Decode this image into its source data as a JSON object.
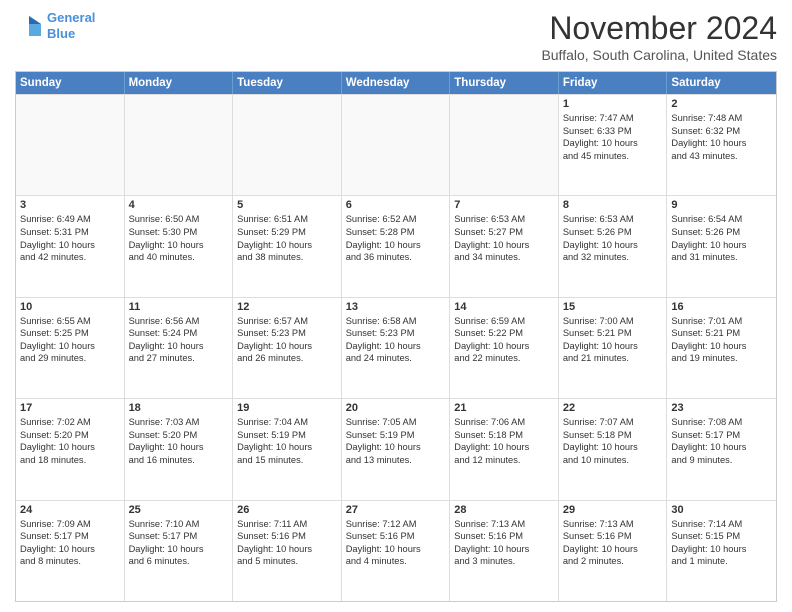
{
  "header": {
    "logo_line1": "General",
    "logo_line2": "Blue",
    "month_title": "November 2024",
    "location": "Buffalo, South Carolina, United States"
  },
  "weekdays": [
    "Sunday",
    "Monday",
    "Tuesday",
    "Wednesday",
    "Thursday",
    "Friday",
    "Saturday"
  ],
  "rows": [
    [
      {
        "day": "",
        "text": "",
        "empty": true
      },
      {
        "day": "",
        "text": "",
        "empty": true
      },
      {
        "day": "",
        "text": "",
        "empty": true
      },
      {
        "day": "",
        "text": "",
        "empty": true
      },
      {
        "day": "",
        "text": "",
        "empty": true
      },
      {
        "day": "1",
        "text": "Sunrise: 7:47 AM\nSunset: 6:33 PM\nDaylight: 10 hours\nand 45 minutes.",
        "empty": false
      },
      {
        "day": "2",
        "text": "Sunrise: 7:48 AM\nSunset: 6:32 PM\nDaylight: 10 hours\nand 43 minutes.",
        "empty": false
      }
    ],
    [
      {
        "day": "3",
        "text": "Sunrise: 6:49 AM\nSunset: 5:31 PM\nDaylight: 10 hours\nand 42 minutes.",
        "empty": false
      },
      {
        "day": "4",
        "text": "Sunrise: 6:50 AM\nSunset: 5:30 PM\nDaylight: 10 hours\nand 40 minutes.",
        "empty": false
      },
      {
        "day": "5",
        "text": "Sunrise: 6:51 AM\nSunset: 5:29 PM\nDaylight: 10 hours\nand 38 minutes.",
        "empty": false
      },
      {
        "day": "6",
        "text": "Sunrise: 6:52 AM\nSunset: 5:28 PM\nDaylight: 10 hours\nand 36 minutes.",
        "empty": false
      },
      {
        "day": "7",
        "text": "Sunrise: 6:53 AM\nSunset: 5:27 PM\nDaylight: 10 hours\nand 34 minutes.",
        "empty": false
      },
      {
        "day": "8",
        "text": "Sunrise: 6:53 AM\nSunset: 5:26 PM\nDaylight: 10 hours\nand 32 minutes.",
        "empty": false
      },
      {
        "day": "9",
        "text": "Sunrise: 6:54 AM\nSunset: 5:26 PM\nDaylight: 10 hours\nand 31 minutes.",
        "empty": false
      }
    ],
    [
      {
        "day": "10",
        "text": "Sunrise: 6:55 AM\nSunset: 5:25 PM\nDaylight: 10 hours\nand 29 minutes.",
        "empty": false
      },
      {
        "day": "11",
        "text": "Sunrise: 6:56 AM\nSunset: 5:24 PM\nDaylight: 10 hours\nand 27 minutes.",
        "empty": false
      },
      {
        "day": "12",
        "text": "Sunrise: 6:57 AM\nSunset: 5:23 PM\nDaylight: 10 hours\nand 26 minutes.",
        "empty": false
      },
      {
        "day": "13",
        "text": "Sunrise: 6:58 AM\nSunset: 5:23 PM\nDaylight: 10 hours\nand 24 minutes.",
        "empty": false
      },
      {
        "day": "14",
        "text": "Sunrise: 6:59 AM\nSunset: 5:22 PM\nDaylight: 10 hours\nand 22 minutes.",
        "empty": false
      },
      {
        "day": "15",
        "text": "Sunrise: 7:00 AM\nSunset: 5:21 PM\nDaylight: 10 hours\nand 21 minutes.",
        "empty": false
      },
      {
        "day": "16",
        "text": "Sunrise: 7:01 AM\nSunset: 5:21 PM\nDaylight: 10 hours\nand 19 minutes.",
        "empty": false
      }
    ],
    [
      {
        "day": "17",
        "text": "Sunrise: 7:02 AM\nSunset: 5:20 PM\nDaylight: 10 hours\nand 18 minutes.",
        "empty": false
      },
      {
        "day": "18",
        "text": "Sunrise: 7:03 AM\nSunset: 5:20 PM\nDaylight: 10 hours\nand 16 minutes.",
        "empty": false
      },
      {
        "day": "19",
        "text": "Sunrise: 7:04 AM\nSunset: 5:19 PM\nDaylight: 10 hours\nand 15 minutes.",
        "empty": false
      },
      {
        "day": "20",
        "text": "Sunrise: 7:05 AM\nSunset: 5:19 PM\nDaylight: 10 hours\nand 13 minutes.",
        "empty": false
      },
      {
        "day": "21",
        "text": "Sunrise: 7:06 AM\nSunset: 5:18 PM\nDaylight: 10 hours\nand 12 minutes.",
        "empty": false
      },
      {
        "day": "22",
        "text": "Sunrise: 7:07 AM\nSunset: 5:18 PM\nDaylight: 10 hours\nand 10 minutes.",
        "empty": false
      },
      {
        "day": "23",
        "text": "Sunrise: 7:08 AM\nSunset: 5:17 PM\nDaylight: 10 hours\nand 9 minutes.",
        "empty": false
      }
    ],
    [
      {
        "day": "24",
        "text": "Sunrise: 7:09 AM\nSunset: 5:17 PM\nDaylight: 10 hours\nand 8 minutes.",
        "empty": false
      },
      {
        "day": "25",
        "text": "Sunrise: 7:10 AM\nSunset: 5:17 PM\nDaylight: 10 hours\nand 6 minutes.",
        "empty": false
      },
      {
        "day": "26",
        "text": "Sunrise: 7:11 AM\nSunset: 5:16 PM\nDaylight: 10 hours\nand 5 minutes.",
        "empty": false
      },
      {
        "day": "27",
        "text": "Sunrise: 7:12 AM\nSunset: 5:16 PM\nDaylight: 10 hours\nand 4 minutes.",
        "empty": false
      },
      {
        "day": "28",
        "text": "Sunrise: 7:13 AM\nSunset: 5:16 PM\nDaylight: 10 hours\nand 3 minutes.",
        "empty": false
      },
      {
        "day": "29",
        "text": "Sunrise: 7:13 AM\nSunset: 5:16 PM\nDaylight: 10 hours\nand 2 minutes.",
        "empty": false
      },
      {
        "day": "30",
        "text": "Sunrise: 7:14 AM\nSunset: 5:15 PM\nDaylight: 10 hours\nand 1 minute.",
        "empty": false
      }
    ]
  ]
}
